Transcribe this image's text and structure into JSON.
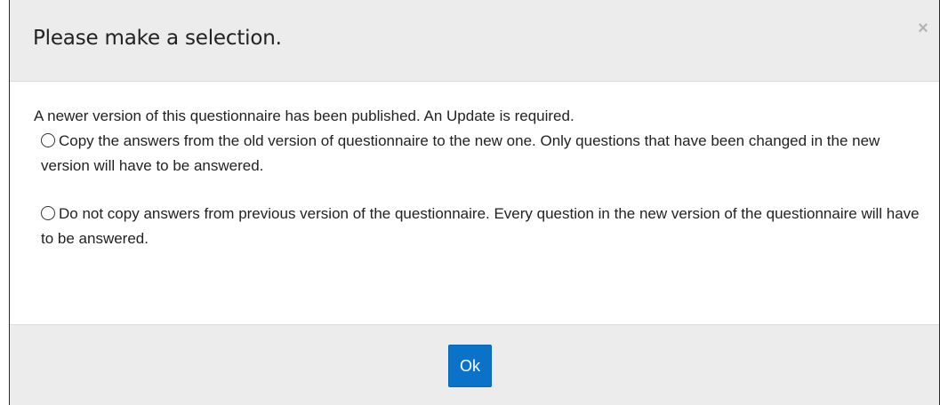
{
  "dialog": {
    "title": "Please make a selection.",
    "close_symbol": "×",
    "intro": "A newer version of this questionnaire has been published. An Update is required.",
    "options": [
      {
        "label": "Copy the answers from the old version of questionnaire to the new one. Only questions that have been changed in the new version will have to be answered.",
        "selected": false
      },
      {
        "label": "Do not copy answers from previous version of the questionnaire. Every question in the new version of the questionnaire will have to be answered.",
        "selected": false
      }
    ],
    "ok_label": "Ok"
  },
  "colors": {
    "header_bg": "#ececec",
    "footer_bg": "#ececec",
    "primary_button": "#0a73c9"
  }
}
